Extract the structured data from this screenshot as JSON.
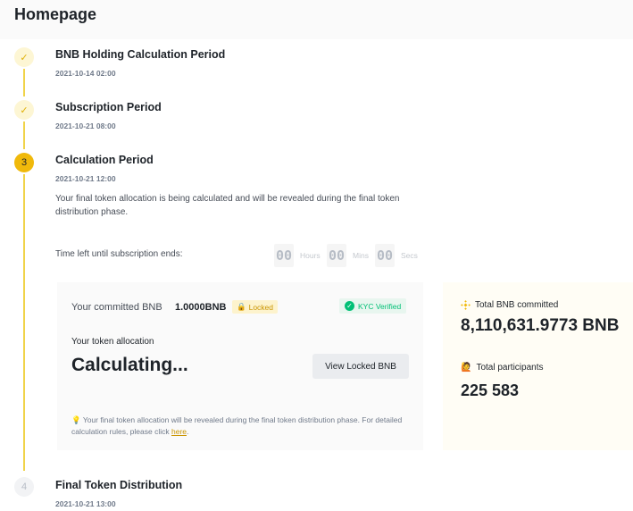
{
  "header": {
    "title": "Homepage"
  },
  "steps": [
    {
      "title": "BNB Holding Calculation Period",
      "date": "2021-10-14 02:00",
      "marker": "✓"
    },
    {
      "title": "Subscription Period",
      "date": "2021-10-21 08:00",
      "marker": "✓"
    },
    {
      "title": "Calculation Period",
      "date": "2021-10-21 12:00",
      "marker": "3",
      "description": "Your final token allocation is being calculated and will be revealed during the final token distribution phase."
    },
    {
      "title": "Final Token Distribution",
      "date": "2021-10-21 13:00",
      "marker": "4"
    }
  ],
  "countdown": {
    "label": "Time left until subscription ends:",
    "hours": "00",
    "hours_unit": "Hours",
    "mins": "00",
    "mins_unit": "Mins",
    "secs": "00",
    "secs_unit": "Secs"
  },
  "card": {
    "committed_label": "Your committed BNB",
    "committed_value": "1.0000BNB",
    "locked_badge": "Locked",
    "kyc_badge": "KYC Verified",
    "allocation_label": "Your token allocation",
    "allocation_value": "Calculating...",
    "view_button": "View Locked BNB",
    "note": "Your final token allocation will be revealed during the final token distribution phase. For detailed calculation rules, please click ",
    "note_link": "here",
    "note_end": "."
  },
  "stats": {
    "total_bnb_label": "Total BNB committed",
    "total_bnb_value": "8,110,631.9773 BNB",
    "participants_label": "Total participants",
    "participants_value": "225 583"
  },
  "colors": {
    "accent": "#f0b90b",
    "success": "#02c076",
    "link": "#c99400"
  }
}
